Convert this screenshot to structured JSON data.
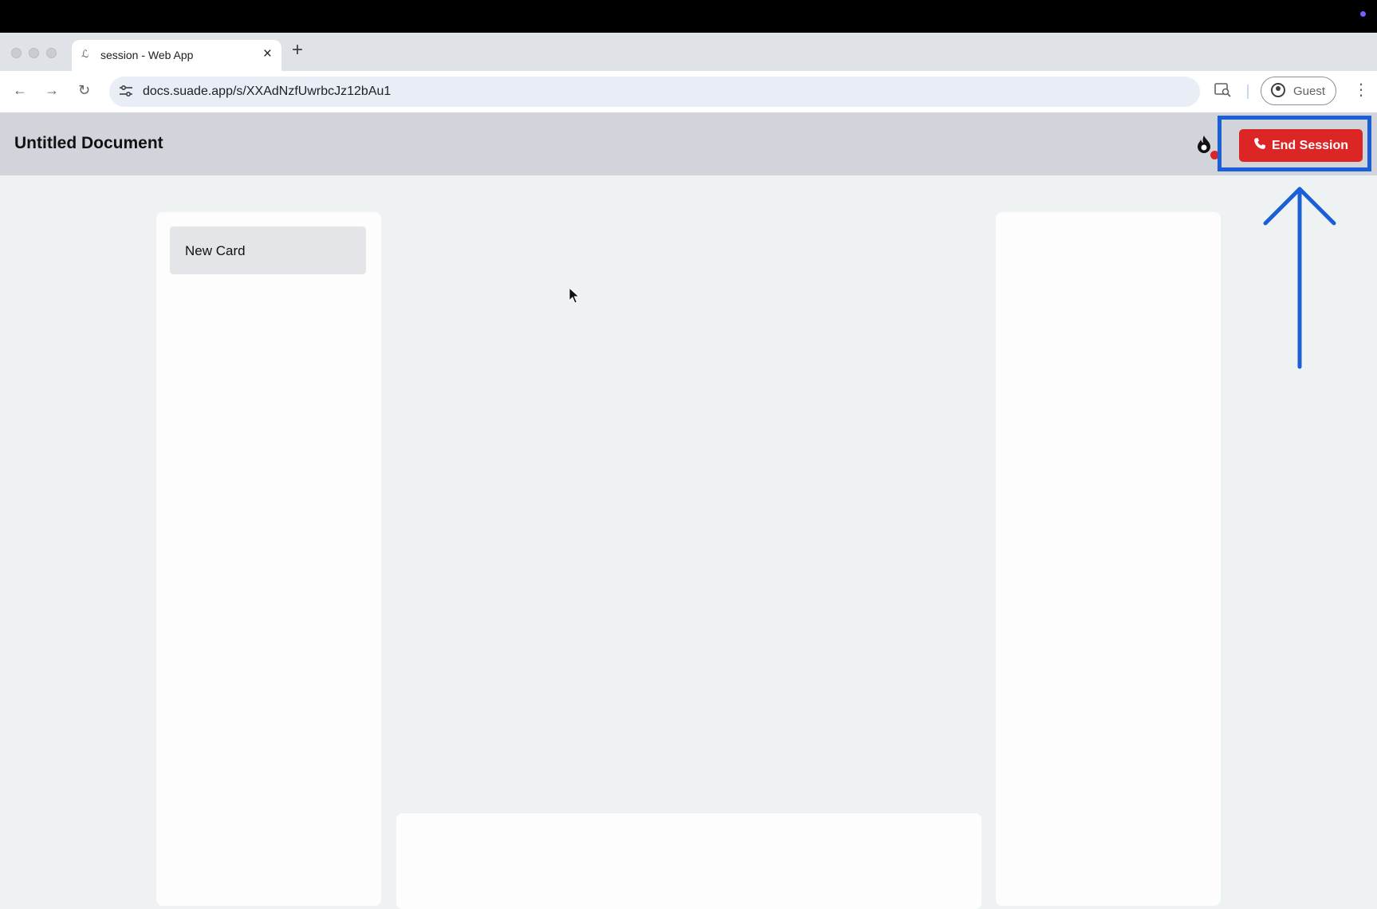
{
  "browser": {
    "tab": {
      "title": "session - Web App",
      "close": "×",
      "favicon": "ℒ"
    },
    "new_tab": "+",
    "nav": {
      "back": "←",
      "forward": "→",
      "reload": "↻"
    },
    "url": "docs.suade.app/s/XXAdNzfUwrbcJz12bAu1",
    "profile_label": "Guest",
    "menu": "⋮"
  },
  "app": {
    "document_title": "Untitled Document",
    "end_session_label": "End Session",
    "end_session_color": "#dc2626",
    "card_label": "New Card"
  },
  "annotation": {
    "highlight_color": "#1a5fd6",
    "target": "end-session-button"
  },
  "icons": [
    "phone-icon",
    "fire-icon",
    "guest-avatar-icon",
    "tune-icon",
    "lens-icon"
  ]
}
